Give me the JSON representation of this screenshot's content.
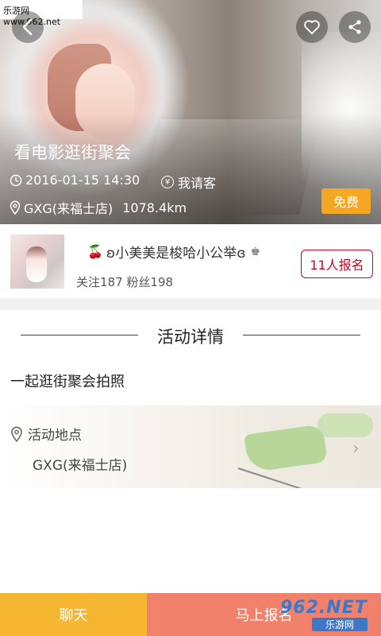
{
  "watermark": {
    "top_text": "乐游网 www.962.net",
    "bottom_brand": "962.NET",
    "bottom_sub": "乐游网"
  },
  "hero": {
    "title": "看电影逛街聚会",
    "datetime": "2016-01-15 14:30",
    "payment": "我请客",
    "payment_icon_char": "¥",
    "location": "GXG(来福士店)",
    "distance": "1078.4km",
    "badge": "免费",
    "badge_color": "#f5a623"
  },
  "icons": {
    "back": "back-chevron-icon",
    "favorite": "heart-icon",
    "share": "share-icon",
    "clock": "clock-icon",
    "yen": "yen-icon",
    "pin": "location-pin-icon"
  },
  "host": {
    "name": "ʚ小美美是梭哈小公举ɞ",
    "cherry": "🍒",
    "crown": "♚",
    "stats": "关注187 粉丝198",
    "signup": "11人报名",
    "signup_color": "#d0021b"
  },
  "section": {
    "title": "活动详情"
  },
  "description": "一起逛街聚会拍照",
  "map": {
    "label": "活动地点",
    "address": "GXG(来福士店)"
  },
  "bottom": {
    "chat": "聊天",
    "join": "马上报名",
    "chat_color": "#f5b731",
    "join_color": "#f2816b"
  }
}
